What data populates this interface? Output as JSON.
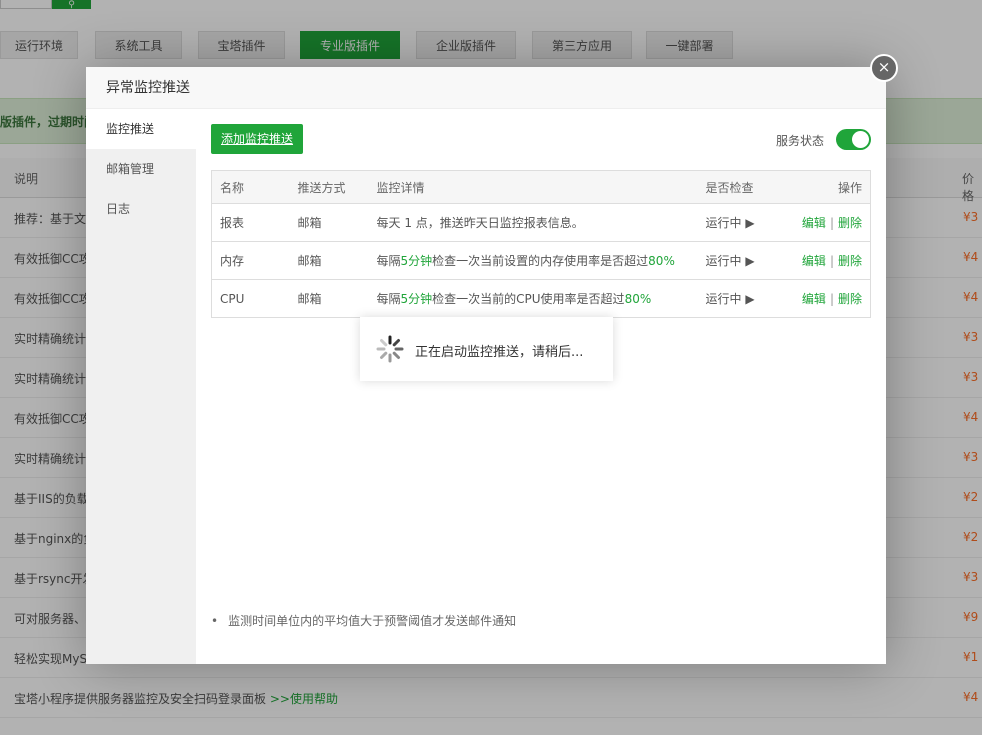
{
  "background": {
    "search_icon": "search-icon",
    "tabs": [
      {
        "label": "运行环境",
        "active": false
      },
      {
        "label": "系统工具",
        "active": false
      },
      {
        "label": "宝塔插件",
        "active": false
      },
      {
        "label": "专业版插件",
        "active": true
      },
      {
        "label": "企业版插件",
        "active": false
      },
      {
        "label": "第三方应用",
        "active": false
      },
      {
        "label": "一键部署",
        "active": false
      }
    ],
    "notice": "版插件，过期时间",
    "columns": {
      "desc": "说明",
      "price": "价格"
    },
    "rows": [
      {
        "desc": "推荐：基于文",
        "price": "¥3"
      },
      {
        "desc": "有效抵御CC攻",
        "price": "¥4"
      },
      {
        "desc": "有效抵御CC攻",
        "price": "¥4"
      },
      {
        "desc": "实时精确统计",
        "price": "¥3"
      },
      {
        "desc": "实时精确统计",
        "price": "¥3"
      },
      {
        "desc": "有效抵御CC攻",
        "price": "¥4"
      },
      {
        "desc": "实时精确统计",
        "price": "¥3"
      },
      {
        "desc": "基于IIS的负载",
        "price": "¥2"
      },
      {
        "desc": "基于nginx的负",
        "price": "¥2"
      },
      {
        "desc": "基于rsync开发",
        "price": "¥3"
      },
      {
        "desc": "可对服务器、",
        "price": "¥9"
      },
      {
        "desc": "轻松实现MyS",
        "price": "¥1"
      },
      {
        "desc": "宝塔小程序提供服务器监控及安全扫码登录面板",
        "link": ">>使用帮助",
        "price": "¥4"
      }
    ]
  },
  "dialog": {
    "title": "异常监控推送",
    "close_glyph": "×",
    "sidebar": [
      {
        "label": "监控推送",
        "active": true
      },
      {
        "label": "邮箱管理",
        "active": false
      },
      {
        "label": "日志",
        "active": false
      }
    ],
    "add_button": "添加监控推送",
    "service_status_label": "服务状态",
    "service_status_on": true,
    "table": {
      "headers": {
        "name": "名称",
        "method": "推送方式",
        "detail": "监控详情",
        "check": "是否检查",
        "op": "操作"
      },
      "rows": [
        {
          "name": "报表",
          "method": "邮箱",
          "detail_pre": "每天 1 点，推送昨天日监控报表信息。",
          "detail_hl1": "",
          "detail_mid": "",
          "detail_hl2": "",
          "status": "运行中 ▶",
          "edit": "编辑",
          "sep": "|",
          "del": "删除"
        },
        {
          "name": "内存",
          "method": "邮箱",
          "detail_pre": "每隔",
          "detail_hl1": "5分钟",
          "detail_mid": "检查一次当前设置的内存使用率是否超过",
          "detail_hl2": "80%",
          "status": "运行中 ▶",
          "edit": "编辑",
          "sep": "|",
          "del": "删除"
        },
        {
          "name": "CPU",
          "method": "邮箱",
          "detail_pre": "每隔",
          "detail_hl1": "5分钟",
          "detail_mid": "检查一次当前的CPU使用率是否超过",
          "detail_hl2": "80%",
          "status": "运行中 ▶",
          "edit": "编辑",
          "sep": "|",
          "del": "删除"
        }
      ]
    },
    "tip": "监测时间单位内的平均值大于预警阈值才发送邮件通知"
  },
  "loading": {
    "text": "正在启动监控推送，请稍后..."
  },
  "colors": {
    "accent": "#20a53a",
    "price": "#fc6d26"
  }
}
